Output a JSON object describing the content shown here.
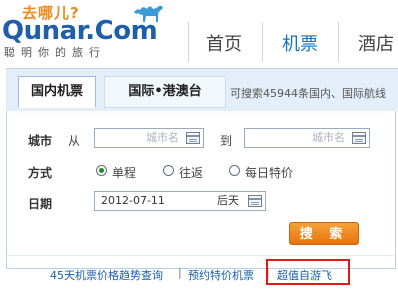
{
  "header": {
    "logo_where": "去哪儿?",
    "logo_text": "Qunar.Com",
    "logo_tagline": "聪明你的旅行",
    "nav": [
      "首页",
      "机票",
      "酒店"
    ]
  },
  "search_panel": {
    "tabs": [
      "国内机票",
      "国际•港澳台"
    ],
    "tab_note": "可搜索45944条国内、国际航线",
    "city_label": "城市",
    "from_label": "从",
    "to_label": "到",
    "city_placeholder": "城市名",
    "mode_label": "方式",
    "modes": [
      {
        "label": "单程",
        "checked": true
      },
      {
        "label": "往返",
        "checked": false
      },
      {
        "label": "每日特价",
        "checked": false
      }
    ],
    "date_label": "日期",
    "date_value": "2012-07-11",
    "date_hint": "后天",
    "search_button": "搜 索"
  },
  "footer": {
    "links": [
      "45天机票价格趋势查询",
      "预约特价机票",
      "超值自游飞"
    ],
    "separator": "|"
  },
  "colors": {
    "accent_blue": "#1a73b8",
    "logo_orange": "#f08a1e",
    "button_orange": "#e7740f",
    "highlight_red": "#e01919"
  }
}
